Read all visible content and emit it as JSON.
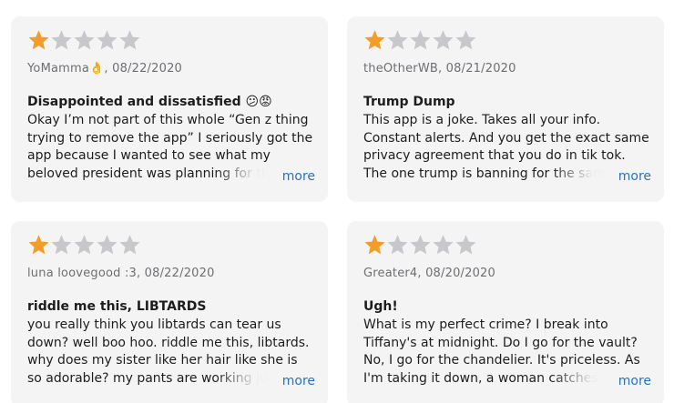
{
  "colors": {
    "star_filled": "#f29d2a",
    "star_empty": "#c7c7cc",
    "card_bg": "#f4f4f5",
    "link": "#2872c4"
  },
  "reviews": [
    {
      "rating": 1,
      "author_date": "YoMamma👌, 08/22/2020",
      "title": "Disappointed and dissatisfied 😕😡",
      "body": "Okay I’m not part of this whole “Gen z thing trying to remove the app” I seriously got the app because I wanted to see what my beloved president was planning for the upcoming election",
      "more_label": "more"
    },
    {
      "rating": 1,
      "author_date": "theOtherWB, 08/21/2020",
      "title": "Trump Dump",
      "body": "This app is a joke. Takes all your info. Constant alerts. And you get the exact same privacy agreement that you do in tik tok. The one trump is banning for the same privacy reasons",
      "more_label": "more"
    },
    {
      "rating": 1,
      "author_date": "luna loovegood :3, 08/22/2020",
      "title": "riddle me this, LIBTARDS",
      "body": "you really think you libtards can tear us down? well boo hoo. riddle me this, libtards. why does my sister like her hair like she is so adorable? my pants are working just fine thank you",
      "more_label": "more"
    },
    {
      "rating": 1,
      "author_date": "Greater4, 08/20/2020",
      "title": "Ugh!",
      "body": "What is my perfect crime? I break into Tiffany's at midnight. Do I go for the vault? No, I go for the chandelier. It's priceless. As I'm taking it down, a woman catches me in the act",
      "more_label": "more"
    }
  ]
}
